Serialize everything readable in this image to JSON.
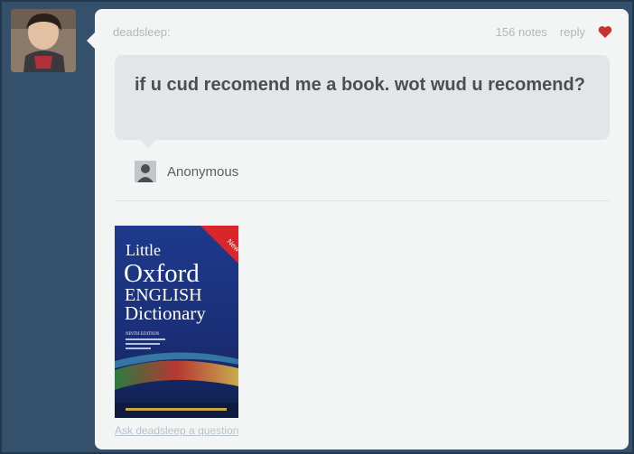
{
  "post": {
    "username": "deadsleep:",
    "notes": "156 notes",
    "reply_label": "reply",
    "heart_icon": "heart-icon",
    "heart_color": "#c8312f"
  },
  "question": {
    "text": "if u cud recomend me a book. wot wud u recomend?",
    "asker": "Anonymous"
  },
  "book": {
    "line1": "Little",
    "line2": "Oxford",
    "line3": "ENGLISH",
    "line4": "Dictionary",
    "badge": "New",
    "edition": "NINTH EDITION"
  },
  "footer": {
    "ask_link": "Ask deadsleep a question"
  },
  "colors": {
    "background": "#34506a",
    "card": "#f3f4f4",
    "question_box": "#e3e6e9",
    "book_blue": "#1c2f78"
  }
}
